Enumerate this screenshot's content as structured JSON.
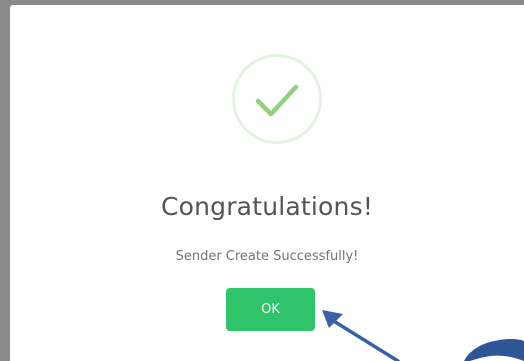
{
  "dialog": {
    "icon": "checkmark-icon",
    "title": "Congratulations!",
    "message": "Sender Create Successfully!",
    "ok_label": "OK"
  },
  "colors": {
    "accent": "#2fc46a",
    "icon_check": "#8fd27a",
    "icon_ring": "#e6f3e4",
    "annotation_arrow": "#3a60a8"
  }
}
